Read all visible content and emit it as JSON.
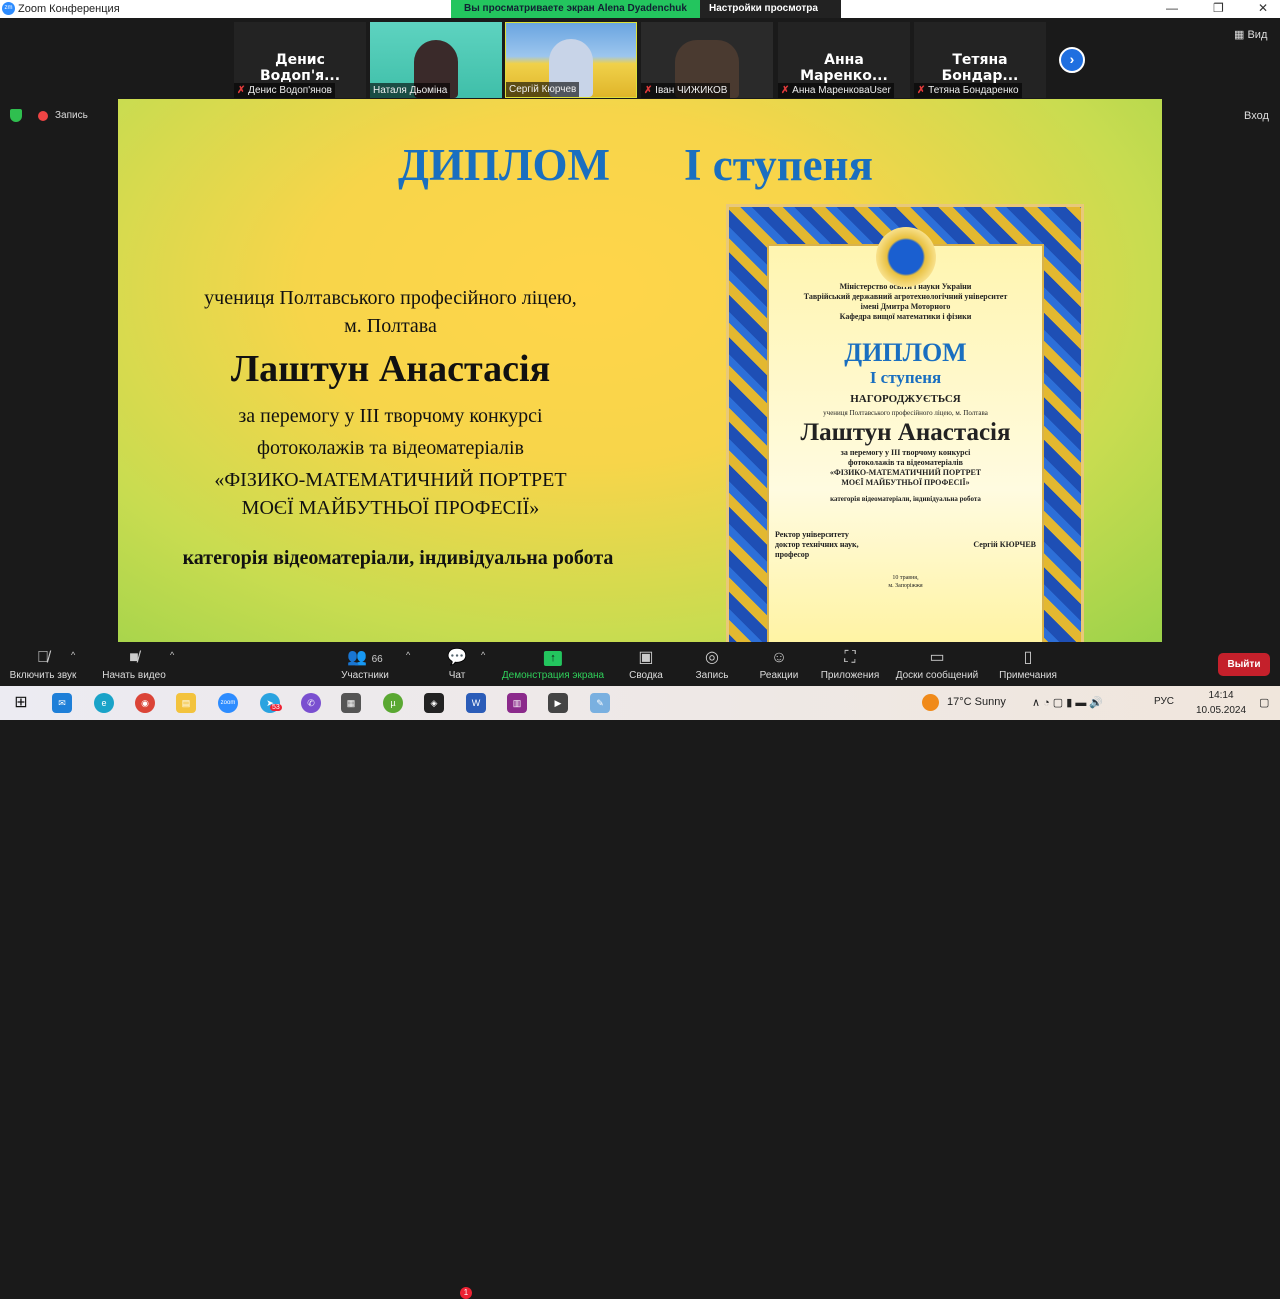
{
  "window": {
    "title": "Zoom Конференция",
    "minimize": "—",
    "maximize": "❐",
    "close": "✕"
  },
  "banner": {
    "text": "Вы просматриваете экран Alena Dyadenchuk",
    "view_settings": "Настройки просмотра",
    "chevron": "⌄"
  },
  "participants": [
    {
      "big": "Денис Водоп'я...",
      "name": "Денис Водоп'янов",
      "muted": true,
      "video": false
    },
    {
      "big": "",
      "name": "Наталя Дьоміна",
      "muted": false,
      "video": true
    },
    {
      "big": "",
      "name": "Сергій Кюрчев",
      "muted": false,
      "video": true
    },
    {
      "big": "",
      "name": "Іван ЧИЖИКОВ",
      "muted": true,
      "video": true
    },
    {
      "big": "Анна Маренко...",
      "name": "Анна МаренковаUser",
      "muted": true,
      "video": false
    },
    {
      "big": "Тетяна Бондар...",
      "name": "Тетяна Бондаренко",
      "muted": true,
      "video": false
    }
  ],
  "next_icon": "›",
  "view_button": "Вид",
  "exit_fullscreen": "Вход",
  "recording": "Запись",
  "slide": {
    "title_left": "ДИПЛОМ",
    "title_right": "І ступеня",
    "line1": "учениця Полтавського професійного ліцею,",
    "line2": "м. Полтава",
    "name": "Лаштун Анастасія",
    "line3": "за перемогу у ІІІ творчому конкурсі",
    "line4": "фотоколажів та відеоматеріалів",
    "line5": "«ФІЗИКО-МАТЕМАТИЧНИЙ ПОРТРЕТ",
    "line6": "МОЄЇ МАЙБУТНЬОЇ ПРОФЕСІЇ»",
    "category": "категорія відеоматеріали, індивідуальна робота"
  },
  "diploma": {
    "h1": "Міністерство освіти і науки України",
    "h2": "Таврійський державний агротехнологічний університет",
    "h3": "імені Дмитра Моторного",
    "h4": "Кафедра вищої математики і фізики",
    "title": "ДИПЛОМ",
    "degree": "І ступеня",
    "awarded": "НАГОРОДЖУЄТЬСЯ",
    "who": "учениця Полтавського професійного ліцею, м. Полтава",
    "name": "Лаштун Анастасія",
    "l1": "за перемогу у ІІІ творчому конкурсі",
    "l2": "фотоколажів та відеоматеріалів",
    "l3": "«ФІЗИКО-МАТЕМАТИЧНИЙ ПОРТРЕТ",
    "l4": "МОЄЇ МАЙБУТНЬОЇ ПРОФЕСІЇ»",
    "category": "категорія відеоматеріали, індивідуальна робота",
    "s1": "Ректор університету",
    "s2": "доктор технічних наук,",
    "s3": "професор",
    "signer": "Сергій КЮРЧЕВ",
    "date": "10 травня,",
    "city": "м. Запоріжжя"
  },
  "toolbar": {
    "unmute": "Включить звук",
    "video": "Начать видео",
    "participants": "Участники",
    "participants_count": "66",
    "chat": "Чат",
    "chat_badge": "1",
    "share": "Демонстрация экрана",
    "summary": "Сводка",
    "record": "Запись",
    "reactions": "Реакции",
    "apps": "Приложения",
    "whiteboards": "Доски сообщений",
    "notes": "Примечания",
    "leave": "Выйти"
  },
  "taskbar": {
    "telegram_badge": "53",
    "weather": "17°C  Sunny",
    "lang": "РУС",
    "time": "14:14",
    "date": "10.05.2024"
  },
  "colors": {
    "accent_green": "#23c55e",
    "diploma_blue": "#1a6fc0",
    "leave_red": "#c4202b"
  }
}
